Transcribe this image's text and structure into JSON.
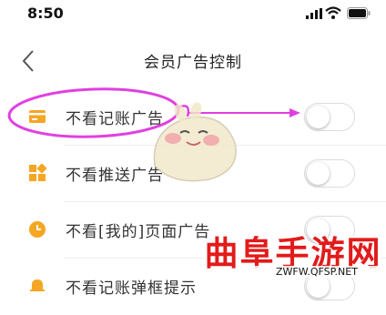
{
  "status_bar": {
    "time": "8:50",
    "icons": [
      "cellular-signal-icon",
      "wifi-icon",
      "battery-icon"
    ]
  },
  "nav": {
    "title": "会员广告控制",
    "back_icon": "chevron-left-icon"
  },
  "settings": {
    "items": [
      {
        "label": "不看记账广告",
        "icon": "card-icon",
        "icon_color": "#F5A623",
        "enabled": false
      },
      {
        "label": "不看推送广告",
        "icon": "grid-icon",
        "icon_color": "#F5A623",
        "enabled": false
      },
      {
        "label": "不看[我的]页面广告",
        "icon": "clock-icon",
        "icon_color": "#F5A623",
        "enabled": false
      },
      {
        "label": "不看记账弹框提示",
        "icon": "bell-icon",
        "icon_color": "#F5A623",
        "enabled": false
      }
    ]
  },
  "annotation": {
    "highlight_color": "#E040E0"
  },
  "watermark": {
    "title": "曲阜手游网",
    "url": "ZWFW.QFSP.NET"
  },
  "colors": {
    "accent": "#F5A623",
    "toggle_off_border": "#DCDCDC",
    "watermark_red": "#E21B1B"
  }
}
